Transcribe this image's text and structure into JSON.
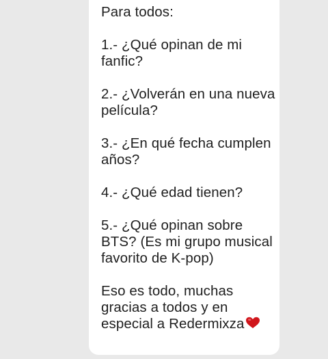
{
  "message": {
    "greeting": "Para todos:",
    "q1": "1.- ¿Qué opinan de mi fanfic?",
    "q2": "2.- ¿Volverán en una nueva película?",
    "q3": "3.- ¿En qué fecha cumplen años?",
    "q4": "4.- ¿Qué edad tienen?",
    "q5": "5.- ¿Qué opinan sobre BTS? (Es mi grupo musical favorito de K-pop)",
    "closing": "Eso es todo, muchas gracias a todos y en especial a Redermixza",
    "emoji": "heart-icon"
  },
  "colors": {
    "background": "#e9e9e9",
    "bubble": "#ffffff",
    "text": "#1e1e1e",
    "heart": "#d0151b"
  }
}
